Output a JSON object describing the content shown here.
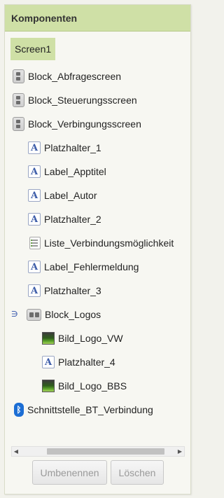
{
  "panel": {
    "title": "Komponenten"
  },
  "tree": {
    "screen": "Screen1",
    "items": [
      {
        "label": "Block_Abfragescreen",
        "icon": "vertical-arrangement-icon"
      },
      {
        "label": "Block_Steuerungsscreen",
        "icon": "vertical-arrangement-icon"
      },
      {
        "label": "Block_Verbingungsscreen",
        "icon": "vertical-arrangement-icon"
      },
      {
        "label": "Platzhalter_1",
        "icon": "label-icon"
      },
      {
        "label": "Label_Apptitel",
        "icon": "label-icon"
      },
      {
        "label": "Label_Autor",
        "icon": "label-icon"
      },
      {
        "label": "Platzhalter_2",
        "icon": "label-icon"
      },
      {
        "label": "Liste_Verbindungsmöglichkeit",
        "icon": "listpicker-icon"
      },
      {
        "label": "Label_Fehlermeldung",
        "icon": "label-icon"
      },
      {
        "label": "Platzhalter_3",
        "icon": "label-icon"
      },
      {
        "label": "Block_Logos",
        "icon": "horizontal-arrangement-icon",
        "toggle": "∋"
      },
      {
        "label": "Bild_Logo_VW",
        "icon": "image-icon"
      },
      {
        "label": "Platzhalter_4",
        "icon": "label-icon"
      },
      {
        "label": "Bild_Logo_BBS",
        "icon": "image-icon"
      },
      {
        "label": "Schnittstelle_BT_Verbindung",
        "icon": "bluetooth-icon"
      }
    ]
  },
  "actions": {
    "rename_label": "Umbenennen",
    "delete_label": "Löschen"
  },
  "colors": {
    "header_bg": "#cfe0a6",
    "selected_bg": "#cfe0a6",
    "panel_bg": "#f7f7f2"
  }
}
